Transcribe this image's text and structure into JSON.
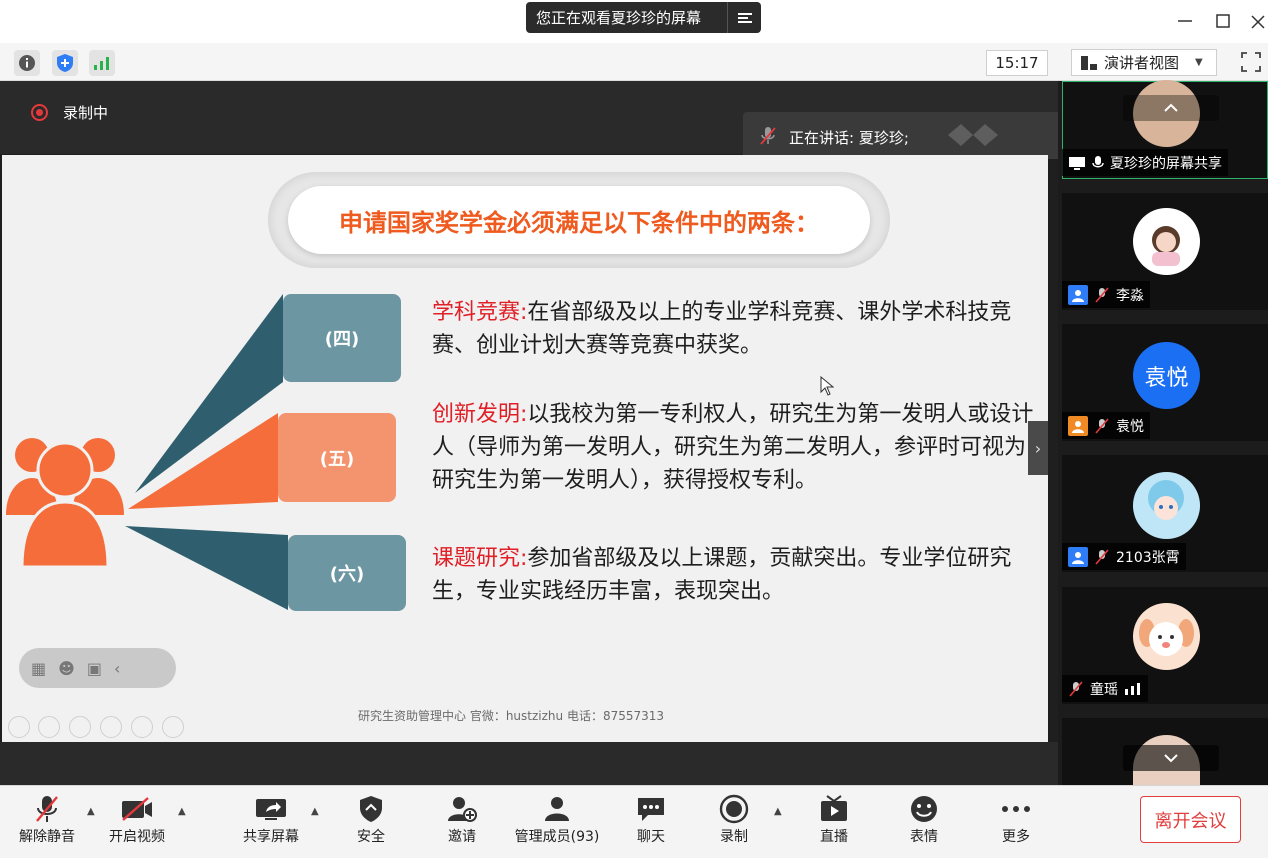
{
  "window": {
    "viewing_text": "您正在观看夏珍珍的屏幕"
  },
  "topbar": {
    "clock": "15:17",
    "view_mode": "演讲者视图"
  },
  "share": {
    "recording_label": "录制中",
    "speaking_label": "正在讲话: 夏珍珍;"
  },
  "slide": {
    "title": "申请国家奖学金必须满足以下条件中的两条：",
    "labels": [
      "(四)",
      "(五)",
      "(六)"
    ],
    "items": [
      {
        "heading": "学科竞赛:",
        "body": "在省部级及以上的专业学科竞赛、课外学术科技竞赛、创业计划大赛等竞赛中获奖。"
      },
      {
        "heading": "创新发明:",
        "body": "以我校为第一专利权人，研究生为第一发明人或设计人（导师为第一发明人，研究生为第二发明人，参评时可视为研究生为第一发明人），获得授权专利。"
      },
      {
        "heading": "课题研究:",
        "body": "参加省部级及以上课题，贡献突出。专业学位研究生，专业实践经历丰富，表现突出。"
      }
    ],
    "footer": "研究生资助管理中心 官微：hustzizhu 电话：87557313"
  },
  "gallery": {
    "participants": [
      {
        "name": "夏珍珍的屏幕共享"
      },
      {
        "name": "李淼"
      },
      {
        "name": "袁悦",
        "avatar_text": "袁悦"
      },
      {
        "name": "2103张霄"
      },
      {
        "name": "童瑶"
      }
    ]
  },
  "toolbar": {
    "unmute": "解除静音",
    "start_video": "开启视频",
    "share_screen": "共享屏幕",
    "security": "安全",
    "invite": "邀请",
    "manage_members": "管理成员(93)",
    "chat": "聊天",
    "record": "录制",
    "live": "直播",
    "reactions": "表情",
    "more": "更多",
    "leave": "离开会议"
  },
  "colors": {
    "accent_orange": "#ef5a1f",
    "heading_red": "#e01f26",
    "teal": "#6d96a3",
    "leave_red": "#e23e3e"
  }
}
